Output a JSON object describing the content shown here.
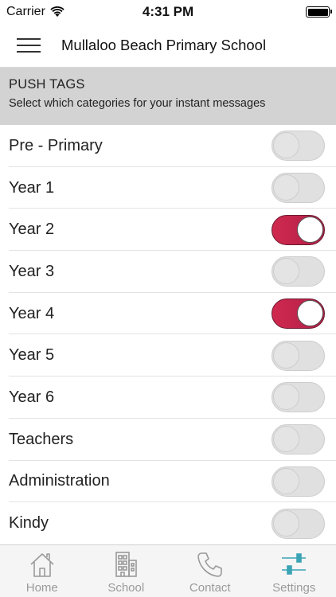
{
  "status_bar": {
    "carrier": "Carrier",
    "time": "4:31 PM"
  },
  "nav": {
    "title": "Mullaloo Beach Primary School"
  },
  "section": {
    "title": "PUSH TAGS",
    "subtitle": "Select which categories for your instant messages"
  },
  "tags": [
    {
      "label": "Pre - Primary",
      "on": false
    },
    {
      "label": "Year 1",
      "on": false
    },
    {
      "label": "Year 2",
      "on": true
    },
    {
      "label": "Year 3",
      "on": false
    },
    {
      "label": "Year 4",
      "on": true
    },
    {
      "label": "Year 5",
      "on": false
    },
    {
      "label": "Year 6",
      "on": false
    },
    {
      "label": "Teachers",
      "on": false
    },
    {
      "label": "Administration",
      "on": false
    },
    {
      "label": "Kindy",
      "on": false
    }
  ],
  "tab_bar": [
    {
      "label": "Home",
      "icon": "home-icon"
    },
    {
      "label": "School",
      "icon": "school-building-icon"
    },
    {
      "label": "Contact",
      "icon": "phone-icon"
    },
    {
      "label": "Settings",
      "icon": "sliders-icon"
    }
  ],
  "colors": {
    "accent": "#c42550",
    "tab_active_icon": "#3aa4b5",
    "header_bg": "#d3d3d3"
  }
}
